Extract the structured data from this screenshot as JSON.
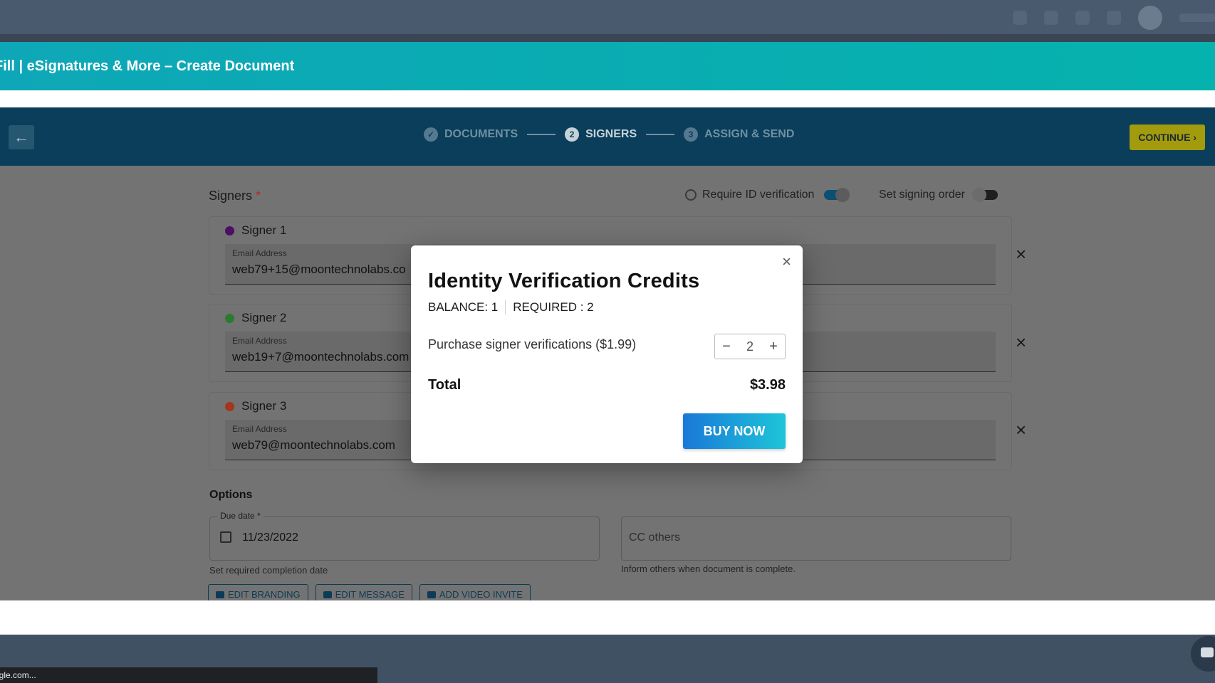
{
  "app_header": {
    "title": "Fill | eSignatures & More – Create Document"
  },
  "stepper": {
    "steps": [
      {
        "num": "✓",
        "label": "DOCUMENTS"
      },
      {
        "num": "2",
        "label": "SIGNERS"
      },
      {
        "num": "3",
        "label": "ASSIGN & SEND"
      }
    ],
    "continue_label": "CONTINUE"
  },
  "signers": {
    "label": "Signers",
    "required_mark": "*",
    "id_verification_label": "Require ID verification",
    "signing_order_label": "Set signing order",
    "list": [
      {
        "name": "Signer 1",
        "color": "#4b0f63",
        "email_label": "Email Address",
        "email": "web79+15@moontechnolabs.co"
      },
      {
        "name": "Signer 2",
        "color": "#2b7a2f",
        "email_label": "Email Address",
        "email": "web19+7@moontechnolabs.com"
      },
      {
        "name": "Signer 3",
        "color": "#a3361c",
        "email_label": "Email Address",
        "email": "web79@moontechnolabs.com"
      }
    ]
  },
  "options": {
    "label": "Options",
    "due_date_label": "Due date *",
    "due_date": "11/23/2022",
    "due_help": "Set required completion date",
    "cc_placeholder": "CC others",
    "cc_help": "Inform others when document is complete.",
    "buttons": [
      "EDIT BRANDING",
      "EDIT MESSAGE",
      "ADD VIDEO INVITE"
    ]
  },
  "modal": {
    "title": "Identity Verification Credits",
    "balance": "BALANCE: 1",
    "required": "REQUIRED : 2",
    "purchase_label": "Purchase signer verifications ($1.99)",
    "quantity": "2",
    "total_label": "Total",
    "total_value": "$3.98",
    "buy_label": "BUY NOW"
  },
  "status_bar": {
    "url": "ogle.com..."
  }
}
